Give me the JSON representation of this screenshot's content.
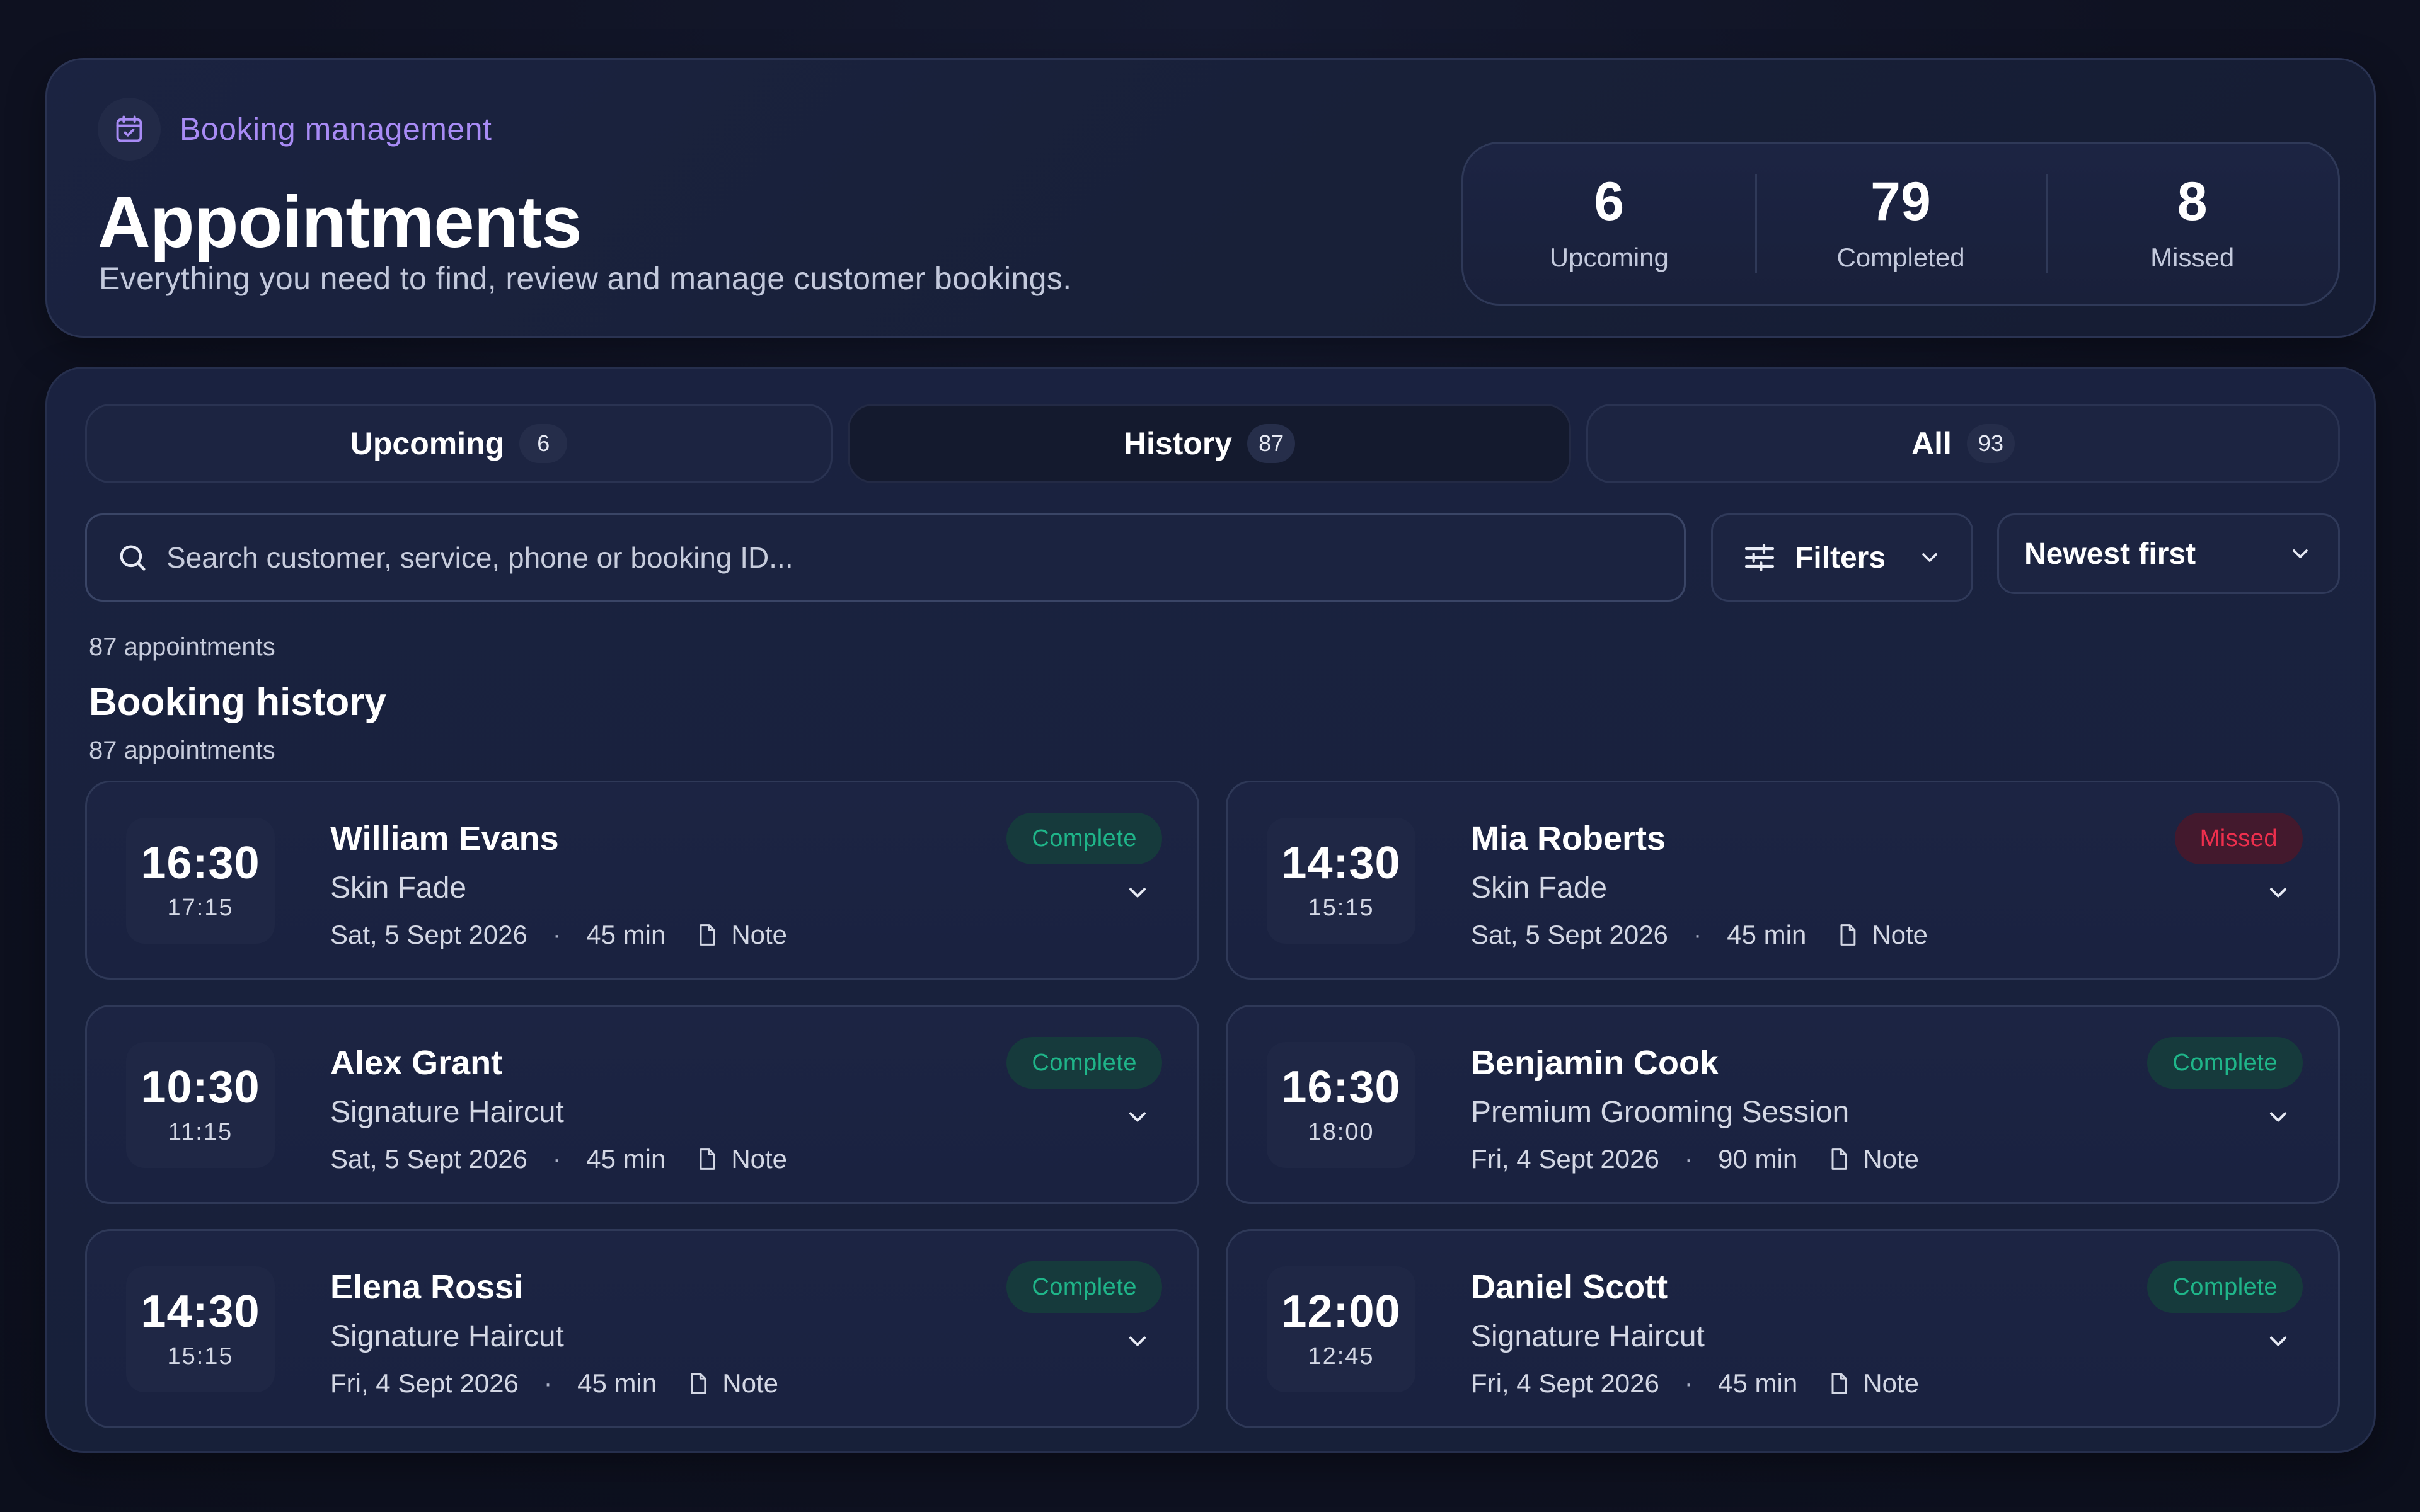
{
  "header": {
    "eyebrow": "Booking management",
    "title": "Appointments",
    "subtitle": "Everything you need to find, review and manage customer bookings."
  },
  "stats": [
    {
      "value": "6",
      "label": "Upcoming"
    },
    {
      "value": "79",
      "label": "Completed"
    },
    {
      "value": "8",
      "label": "Missed"
    }
  ],
  "tabs": [
    {
      "label": "Upcoming",
      "count": "6",
      "active": false
    },
    {
      "label": "History",
      "count": "87",
      "active": true
    },
    {
      "label": "All",
      "count": "93",
      "active": false
    }
  ],
  "search": {
    "placeholder": "Search customer, service, phone or booking ID...",
    "value": ""
  },
  "filters": {
    "label": "Filters"
  },
  "sort": {
    "selected": "Newest first"
  },
  "list": {
    "count_top": "87 appointments",
    "title": "Booking history",
    "count_bottom": "87 appointments"
  },
  "appointments": [
    {
      "start": "16:30",
      "end": "17:15",
      "name": "William Evans",
      "service": "Skin Fade",
      "date": "Sat, 5 Sept 2026",
      "duration": "45 min",
      "note": "Note",
      "status": "Complete",
      "status_kind": "complete"
    },
    {
      "start": "14:30",
      "end": "15:15",
      "name": "Mia Roberts",
      "service": "Skin Fade",
      "date": "Sat, 5 Sept 2026",
      "duration": "45 min",
      "note": "Note",
      "status": "Missed",
      "status_kind": "missed"
    },
    {
      "start": "10:30",
      "end": "11:15",
      "name": "Alex Grant",
      "service": "Signature Haircut",
      "date": "Sat, 5 Sept 2026",
      "duration": "45 min",
      "note": "Note",
      "status": "Complete",
      "status_kind": "complete"
    },
    {
      "start": "16:30",
      "end": "18:00",
      "name": "Benjamin Cook",
      "service": "Premium Grooming Session",
      "date": "Fri, 4 Sept 2026",
      "duration": "90 min",
      "note": "Note",
      "status": "Complete",
      "status_kind": "complete"
    },
    {
      "start": "14:30",
      "end": "15:15",
      "name": "Elena Rossi",
      "service": "Signature Haircut",
      "date": "Fri, 4 Sept 2026",
      "duration": "45 min",
      "note": "Note",
      "status": "Complete",
      "status_kind": "complete"
    },
    {
      "start": "12:00",
      "end": "12:45",
      "name": "Daniel Scott",
      "service": "Signature Haircut",
      "date": "Fri, 4 Sept 2026",
      "duration": "45 min",
      "note": "Note",
      "status": "Complete",
      "status_kind": "complete"
    }
  ],
  "icons": {
    "eyebrow": "calendar-icon",
    "search": "search-icon",
    "filters": "sliders-icon",
    "dropdown": "chevron-down-icon",
    "note": "document-icon"
  },
  "colors": {
    "accent": "#a88bf5",
    "complete": "#1fb589",
    "missed": "#ee2f4d",
    "background": "#0f1222"
  }
}
